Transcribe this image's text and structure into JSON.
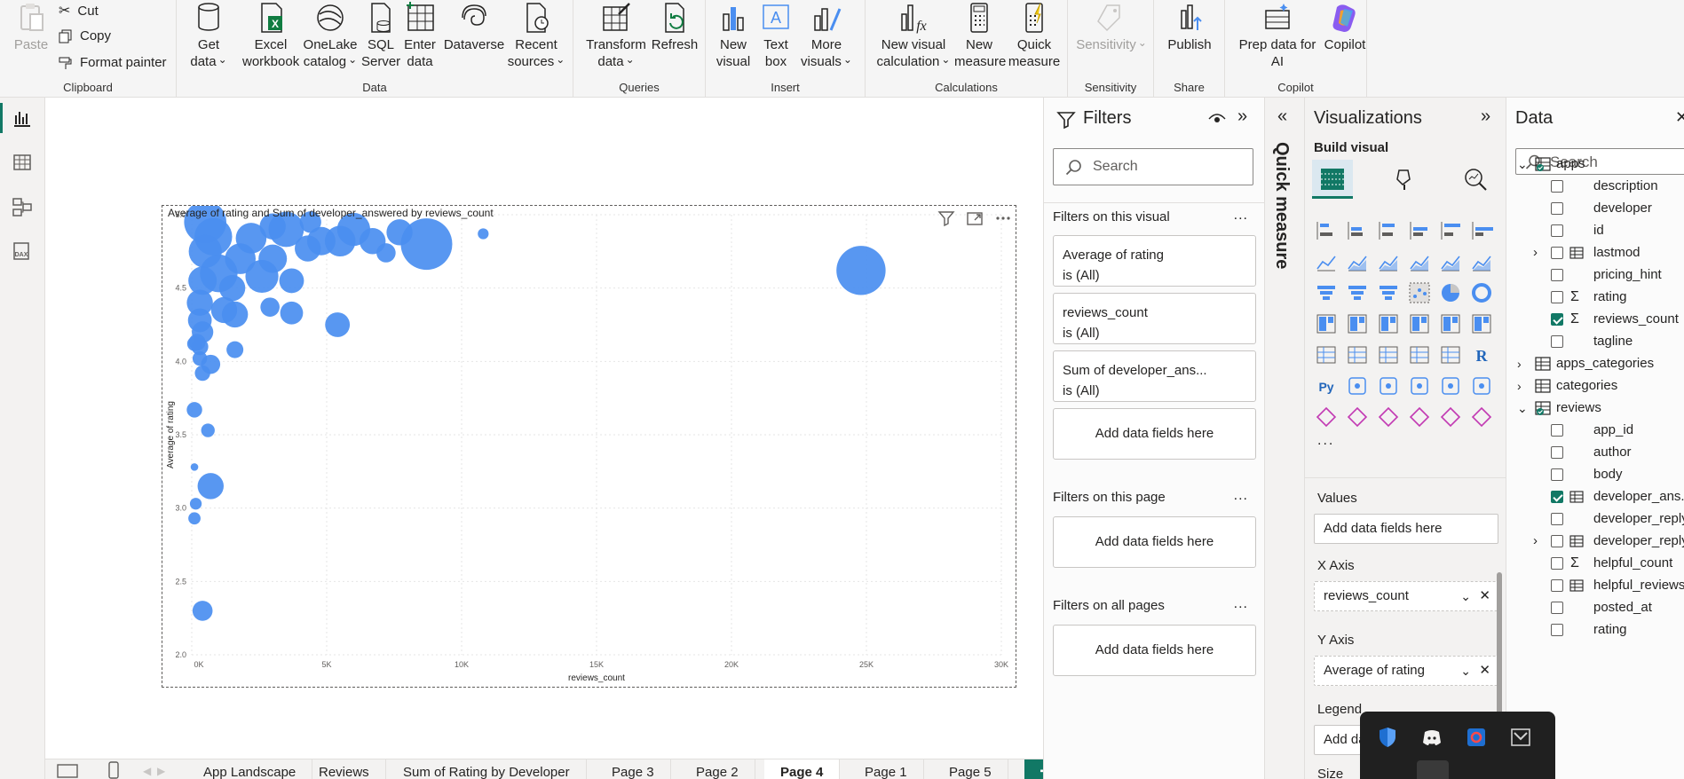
{
  "ribbon": {
    "clipboard": {
      "group": "Clipboard",
      "paste": "Paste",
      "cut": "Cut",
      "copy": "Copy",
      "format_painter": "Format painter"
    },
    "data": {
      "group": "Data",
      "get_data": [
        "Get",
        "data"
      ],
      "excel": [
        "Excel",
        "workbook"
      ],
      "onelake": [
        "OneLake",
        "catalog"
      ],
      "sql": [
        "SQL",
        "Server"
      ],
      "enter": [
        "Enter",
        "data"
      ],
      "dataverse": "Dataverse",
      "recent": [
        "Recent",
        "sources"
      ]
    },
    "queries": {
      "group": "Queries",
      "transform": [
        "Transform",
        "data"
      ],
      "refresh": "Refresh"
    },
    "insert": {
      "group": "Insert",
      "new_visual": [
        "New",
        "visual"
      ],
      "text_box": [
        "Text",
        "box"
      ],
      "more_visuals": [
        "More",
        "visuals"
      ]
    },
    "calculations": {
      "group": "Calculations",
      "new_visual_calc": [
        "New visual",
        "calculation"
      ],
      "new_measure": [
        "New",
        "measure"
      ],
      "quick_measure": [
        "Quick",
        "measure"
      ]
    },
    "sensitivity": {
      "group": "Sensitivity",
      "label": "Sensitivity"
    },
    "share": {
      "group": "Share",
      "publish": "Publish"
    },
    "copilot": {
      "group": "Copilot",
      "prep": [
        "Prep data for",
        "AI"
      ],
      "copilot": "Copilot"
    }
  },
  "chart_data": {
    "type": "scatter",
    "title": "Average of rating and Sum of developer_answered by reviews_count",
    "xlabel": "reviews_count",
    "ylabel": "Average of rating",
    "xlim": [
      0,
      30000
    ],
    "ylim": [
      2.0,
      5.0
    ],
    "x_ticks": [
      "0K",
      "5K",
      "10K",
      "15K",
      "20K",
      "25K",
      "30K"
    ],
    "y_ticks": [
      "2.0",
      "2.5",
      "3.0",
      "3.5",
      "4.0",
      "4.5",
      "5.0"
    ],
    "color": "#4a8ef0",
    "points": [
      {
        "x": 24800,
        "y": 4.62,
        "size": 0.95
      },
      {
        "x": 8700,
        "y": 4.8,
        "size": 1.0
      },
      {
        "x": 10800,
        "y": 4.87,
        "size": 0.12
      },
      {
        "x": 7700,
        "y": 4.88,
        "size": 0.45
      },
      {
        "x": 6700,
        "y": 4.82,
        "size": 0.45
      },
      {
        "x": 6000,
        "y": 4.9,
        "size": 0.6
      },
      {
        "x": 5500,
        "y": 4.82,
        "size": 0.55
      },
      {
        "x": 7200,
        "y": 4.74,
        "size": 0.3
      },
      {
        "x": 4800,
        "y": 4.82,
        "size": 0.5
      },
      {
        "x": 4300,
        "y": 4.77,
        "size": 0.45
      },
      {
        "x": 4400,
        "y": 4.95,
        "size": 0.35
      },
      {
        "x": 3500,
        "y": 4.9,
        "size": 0.65
      },
      {
        "x": 3000,
        "y": 4.92,
        "size": 0.45
      },
      {
        "x": 5400,
        "y": 4.25,
        "size": 0.42
      },
      {
        "x": 3700,
        "y": 4.55,
        "size": 0.42
      },
      {
        "x": 3700,
        "y": 4.33,
        "size": 0.38
      },
      {
        "x": 2900,
        "y": 4.37,
        "size": 0.3
      },
      {
        "x": 2600,
        "y": 4.58,
        "size": 0.6
      },
      {
        "x": 3000,
        "y": 4.7,
        "size": 0.5
      },
      {
        "x": 2200,
        "y": 4.84,
        "size": 0.55
      },
      {
        "x": 1800,
        "y": 4.7,
        "size": 0.55
      },
      {
        "x": 1500,
        "y": 4.5,
        "size": 0.45
      },
      {
        "x": 1200,
        "y": 4.35,
        "size": 0.45
      },
      {
        "x": 1600,
        "y": 4.32,
        "size": 0.45
      },
      {
        "x": 1600,
        "y": 4.08,
        "size": 0.25
      },
      {
        "x": 800,
        "y": 4.85,
        "size": 0.7
      },
      {
        "x": 500,
        "y": 4.75,
        "size": 0.6
      },
      {
        "x": 400,
        "y": 4.55,
        "size": 0.5
      },
      {
        "x": 300,
        "y": 4.4,
        "size": 0.45
      },
      {
        "x": 300,
        "y": 4.28,
        "size": 0.4
      },
      {
        "x": 400,
        "y": 4.2,
        "size": 0.35
      },
      {
        "x": 200,
        "y": 4.13,
        "size": 0.25
      },
      {
        "x": 100,
        "y": 4.12,
        "size": 0.2
      },
      {
        "x": 300,
        "y": 4.1,
        "size": 0.25
      },
      {
        "x": 700,
        "y": 3.98,
        "size": 0.3
      },
      {
        "x": 300,
        "y": 4.02,
        "size": 0.2
      },
      {
        "x": 400,
        "y": 3.92,
        "size": 0.22
      },
      {
        "x": 100,
        "y": 3.67,
        "size": 0.22
      },
      {
        "x": 600,
        "y": 3.53,
        "size": 0.18
      },
      {
        "x": 100,
        "y": 3.28,
        "size": 0.05
      },
      {
        "x": 700,
        "y": 3.15,
        "size": 0.45
      },
      {
        "x": 150,
        "y": 3.03,
        "size": 0.14
      },
      {
        "x": 100,
        "y": 2.93,
        "size": 0.15
      },
      {
        "x": 400,
        "y": 2.3,
        "size": 0.32
      },
      {
        "x": 1000,
        "y": 4.6,
        "size": 0.7
      },
      {
        "x": 500,
        "y": 4.95,
        "size": 0.8
      }
    ]
  },
  "visual_header": {
    "filter_icon": "filter-icon",
    "focus_icon": "focus-mode-icon",
    "more_icon": "more-options-icon"
  },
  "pages": {
    "tabs": [
      "App Landscape",
      "Reviews",
      "Sum of Rating by Developer",
      "Page 3",
      "Page 2",
      "Page 4",
      "Page 1",
      "Page 5"
    ],
    "active": "Page 4",
    "add": "+"
  },
  "filters": {
    "title": "Filters",
    "search_placeholder": "Search",
    "on_visual": "Filters on this visual",
    "cards": [
      {
        "field": "Average of rating",
        "state": "is (All)"
      },
      {
        "field": "reviews_count",
        "state": "is (All)"
      },
      {
        "field": "Sum of developer_ans...",
        "state": "is (All)"
      }
    ],
    "add_fields": "Add data fields here",
    "on_page": "Filters on this page",
    "on_all": "Filters on all pages",
    "more": "..."
  },
  "quick_measure": {
    "label": "Quick measure"
  },
  "visualizations": {
    "title": "Visualizations",
    "build_visual": "Build visual",
    "more": "...",
    "values_label": "Values",
    "values_placeholder": "Add data fields here",
    "xaxis_label": "X Axis",
    "xaxis_field": "reviews_count",
    "yaxis_label": "Y Axis",
    "yaxis_field": "Average of rating",
    "legend_label": "Legend",
    "legend_placeholder": "Add da",
    "size_label": "Size",
    "accent": "#117865"
  },
  "data_pane": {
    "title": "Data",
    "search_placeholder": "Search",
    "rows": [
      {
        "level": 0,
        "kind": "table",
        "expanded": true,
        "checked_badge": true,
        "label": "apps"
      },
      {
        "level": 1,
        "kind": "field",
        "label": "description"
      },
      {
        "level": 1,
        "kind": "field",
        "label": "developer"
      },
      {
        "level": 1,
        "kind": "field",
        "label": "id"
      },
      {
        "level": 1,
        "kind": "hierarchy",
        "label": "lastmod"
      },
      {
        "level": 1,
        "kind": "field",
        "label": "pricing_hint"
      },
      {
        "level": 1,
        "kind": "sum",
        "label": "rating"
      },
      {
        "level": 1,
        "kind": "sum",
        "checked": true,
        "label": "reviews_count"
      },
      {
        "level": 1,
        "kind": "field",
        "label": "tagline"
      },
      {
        "level": 0,
        "kind": "table",
        "expanded": false,
        "label": "apps_categories"
      },
      {
        "level": 0,
        "kind": "table",
        "expanded": false,
        "label": "categories"
      },
      {
        "level": 0,
        "kind": "table",
        "expanded": true,
        "checked_badge": true,
        "label": "reviews"
      },
      {
        "level": 1,
        "kind": "field",
        "label": "app_id"
      },
      {
        "level": 1,
        "kind": "field",
        "label": "author"
      },
      {
        "level": 1,
        "kind": "field",
        "label": "body"
      },
      {
        "level": 1,
        "kind": "calc",
        "checked": true,
        "label": "developer_ans..."
      },
      {
        "level": 1,
        "kind": "field",
        "label": "developer_reply"
      },
      {
        "level": 1,
        "kind": "hierarchy",
        "label": "developer_reply"
      },
      {
        "level": 1,
        "kind": "sum",
        "label": "helpful_count"
      },
      {
        "level": 1,
        "kind": "calc",
        "label": "helpful_reviews"
      },
      {
        "level": 1,
        "kind": "field",
        "label": "posted_at"
      },
      {
        "level": 1,
        "kind": "field",
        "label": "rating"
      }
    ]
  },
  "tray": {
    "icons": [
      "defender-icon",
      "discord-icon",
      "app-icon",
      "media-icon",
      "warning-shield-icon",
      "network-icon",
      "vs-icon"
    ]
  }
}
